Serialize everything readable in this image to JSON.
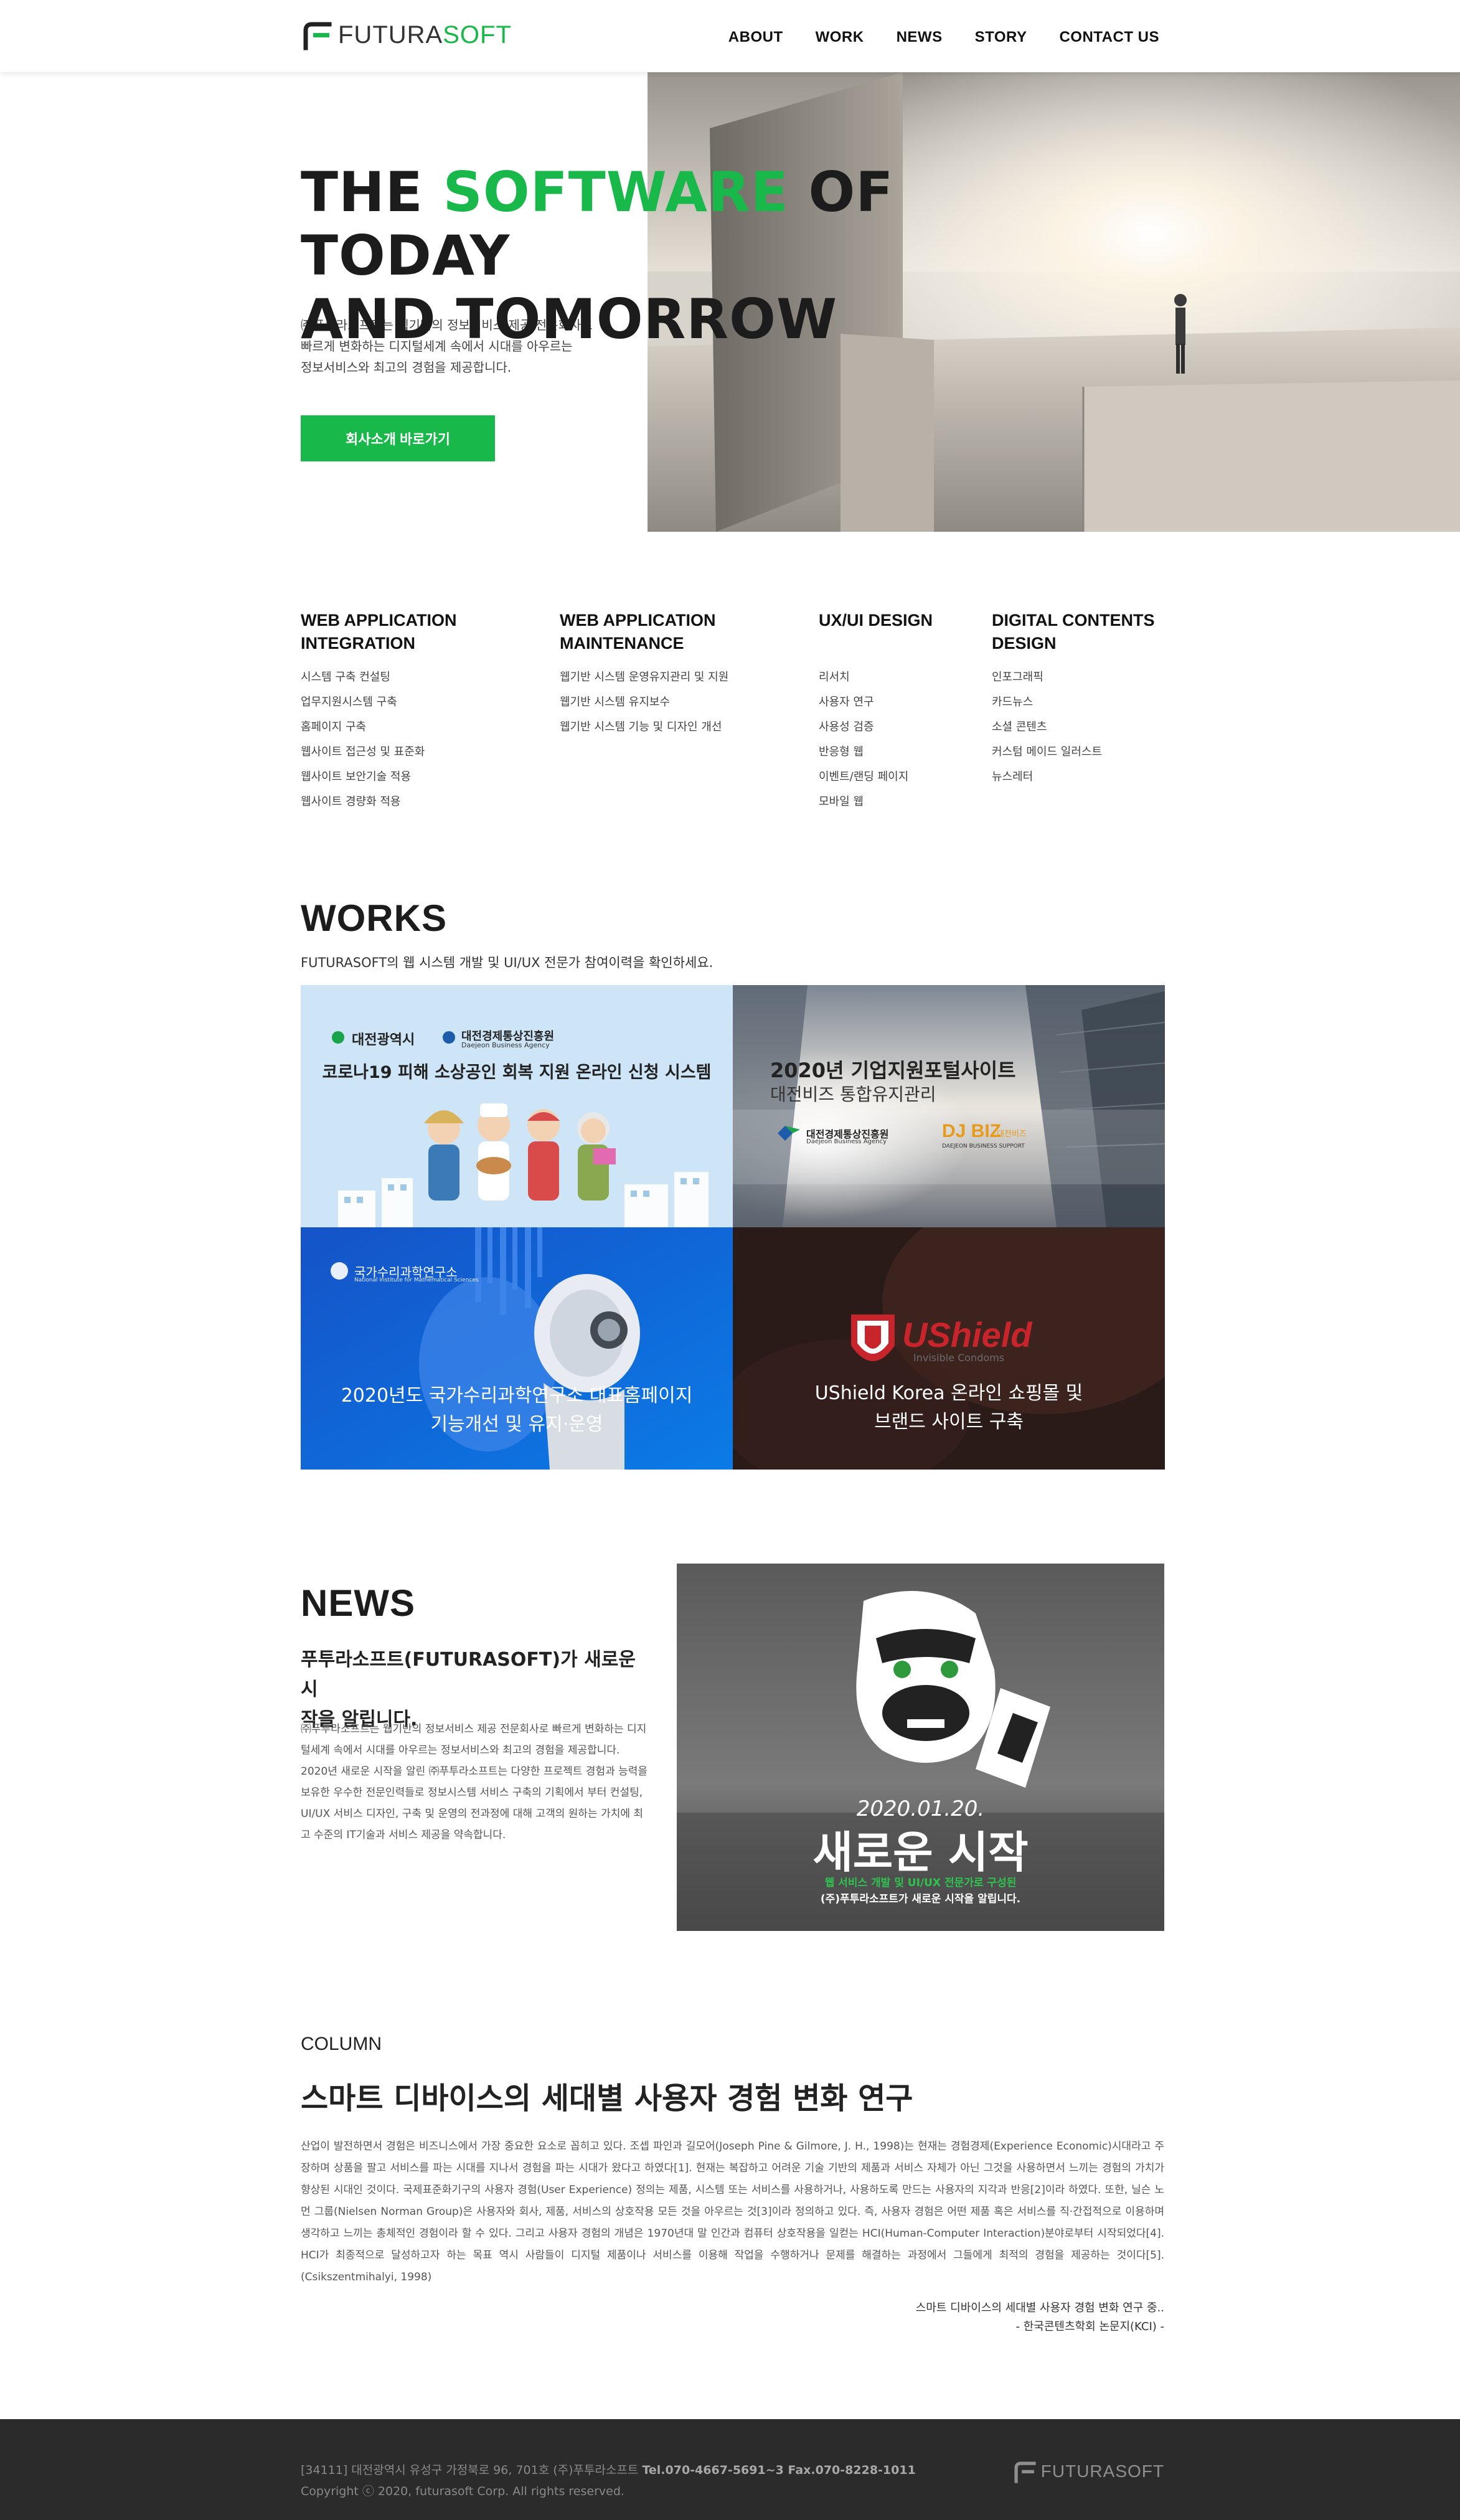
{
  "header": {
    "logo_text_a": "FUTURA",
    "logo_text_b": "SOFT",
    "nav": [
      "ABOUT",
      "WORK",
      "NEWS",
      "STORY",
      "CONTACT US"
    ]
  },
  "hero": {
    "title_line1_a": "THE ",
    "title_line1_b": "SOFTWARE",
    "title_line1_c": " OF TODAY",
    "title_line2": "AND TOMORROW",
    "desc_1": "㈜푸투라소프트는 웹기반의 정보서비스 제공 전문회사로",
    "desc_2": "빠르게 변화하는 디지털세계 속에서 시대를 아우르는",
    "desc_3": "정보서비스와 최고의 경험을 제공합니다.",
    "button": "회사소개 바로가기"
  },
  "services": [
    {
      "title_1": "WEB APPLICATION",
      "title_2": "INTEGRATION",
      "items": [
        "시스템 구축 컨설팅",
        "업무지원시스템 구축",
        "홈페이지 구축",
        "웹사이트 접근성 및 표준화",
        "웹사이트 보안기술 적용",
        "웹사이트 경량화 적용"
      ]
    },
    {
      "title_1": "WEB APPLICATION",
      "title_2": "MAINTENANCE",
      "items": [
        "웹기반 시스템 운영유지관리 및  지원",
        "웹기반 시스템 유지보수",
        "웹기반 시스템 기능 및 디자인  개선"
      ]
    },
    {
      "title_1": "UX/UI DESIGN",
      "title_2": "",
      "items": [
        "리서치",
        "사용자 연구",
        "사용성 검증",
        "반응형 웹",
        "이벤트/랜딩 페이지",
        "모바일 웹"
      ]
    },
    {
      "title_1": "DIGITAL CONTENTS",
      "title_2": "DESIGN",
      "items": [
        "인포그래픽",
        "카드뉴스",
        "소셜 콘텐츠",
        "커스텀 메이드 일러스트",
        "뉴스레터"
      ]
    }
  ],
  "works": {
    "title": "WORKS",
    "subtitle": "FUTURASOFT의 웹 시스템 개발 및 UI/UX 전문가 참여이력을 확인하세요.",
    "tiles": [
      {
        "org_1": "대전광역시",
        "org_2": "대전경제통상진흥원",
        "org_2_en": "Daejeon Business Agency",
        "caption": "코로나19 피해 소상공인 회복 지원 온라인 신청 시스템"
      },
      {
        "caption_1": "2020년 기업지원포털사이트",
        "caption_2": "대전비즈 통합유지관리",
        "org_1": "대전경제통상진흥원",
        "org_1_en": "Daejeon Business Agency",
        "org_2": "DJ BIZ",
        "org_2_sub": "대전비즈",
        "org_2_en": "DAEJEON BUSINESS SUPPORT"
      },
      {
        "org": "국가수리과학연구소",
        "org_en": "National Institute for Mathematical Sciences",
        "caption_1": "2020년도 국가수리과학연구소 대표홈페이지",
        "caption_2": "기능개선 및 유지·운영"
      },
      {
        "brand": "UShield",
        "brand_sub": "Invisible Condoms",
        "caption_1": "UShield Korea 온라인 쇼핑몰 및",
        "caption_2": "브랜드 사이트 구축"
      }
    ]
  },
  "news": {
    "title": "NEWS",
    "headline_1": "푸투라소프트(FUTURASOFT)가 새로운 시",
    "headline_2": "작을 알립니다.",
    "body": "㈜푸투라소프트는 웹기반의 정보서비스 제공 전문회사로 빠르게 변화하는 디지털세계 속에서 시대를 아우르는 정보서비스와 최고의 경험을 제공합니다. 2020년 새로운 시작을 알린 ㈜푸투라소프트는 다양한 프로젝트 경험과 능력을 보유한 우수한 전문인력들로 정보시스템 서비스 구축의 기획에서 부터 컨설팅, UI/UX 서비스 디자인, 구축 및 운영의 전과정에 대해 고객의 원하는 가치에 최고 수준의 IT기술과 서비스 제공을 약속합니다.",
    "image": {
      "date": "2020.01.20.",
      "big": "새로운 시작",
      "line1": "웹 서비스 개발 및 UI/UX 전문가로 구성된",
      "line2": "(주)푸투라소프트가 새로운 시작을 알립니다."
    }
  },
  "column": {
    "label": "COLUMN",
    "title": "스마트 디바이스의 세대별 사용자 경험 변화 연구",
    "body": "산업이 발전하면서 경험은 비즈니스에서 가장 중요한 요소로 꼽히고 있다. 조셉 파인과 길모어(Joseph Pine & Gilmore, J. H., 1998)는 현재는 경험경제(Experience Economic)시대라고 주장하며 상품을 팔고 서비스를 파는 시대를 지나서 경험을 파는 시대가 왔다고 하였다[1]. 현재는 복잡하고 어려운 기술 기반의 제품과 서비스 자체가 아닌 그것을 사용하면서 느끼는 경험의 가치가 향상된 시대인 것이다. 국제표준화기구의 사용자 경험(User Experience) 정의는 제품, 시스템 또는 서비스를 사용하거나, 사용하도록 만드는 사용자의 지각과 반응[2]이라 하였다. 또한, 닐슨 노먼 그룹(Nielsen Norman Group)은 사용자와 회사, 제품, 서비스의 상호작용 모든 것을 아우르는 것[3]이라 정의하고 있다. 즉, 사용자 경험은 어떤 제품 혹은 서비스를 직·간접적으로 이용하며 생각하고 느끼는 총체적인 경험이라 할 수 있다. 그리고 사용자 경험의 개념은 1970년대 말 인간과 컴퓨터 상호작용을 일컫는 HCI(Human-Computer Interaction)분야로부터 시작되었다[4]. HCI가 최종적으로 달성하고자 하는 목표 역시 사람들이 디지털 제품이나 서비스를 이용해 작업을 수행하거나 문제를 해결하는 과정에서 그들에게 최적의 경험을 제공하는 것이다[5].(Csikszentmihalyi, 1998)",
    "source_1": "스마트 디바이스의 세대별 사용자 경험 변화 연구 중..",
    "source_2": "- 한국콘텐츠학회 논문지(KCI) -"
  },
  "footer": {
    "address": "[34111] 대전광역시 유성구 가정북로 96, 701호 (주)푸투라소프트 ",
    "tel": "Tel.070-4667-5691~3  Fax.070-8228-1011",
    "copyright": "Copyright ⓒ 2020, futurasoft Corp. All rights reserved.",
    "logo": "FUTURASOFT"
  },
  "colors": {
    "accent": "#19b84a",
    "footer_bg": "#2b2b2b"
  }
}
